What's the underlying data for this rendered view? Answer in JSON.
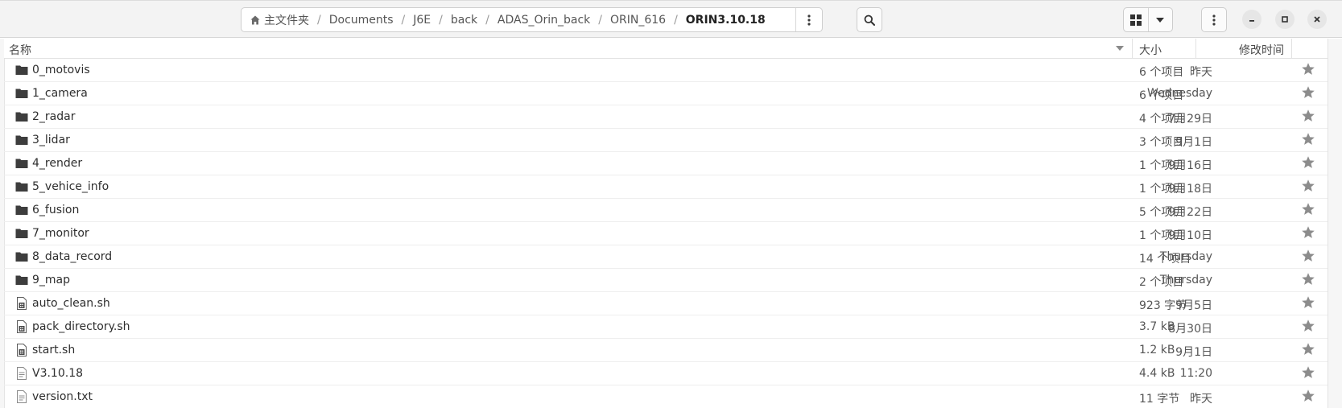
{
  "breadcrumbs": [
    "主文件夹",
    "Documents",
    "J6E",
    "back",
    "ADAS_Orin_back",
    "ORIN_616",
    "ORIN3.10.18"
  ],
  "columns": {
    "name": "名称",
    "size": "大小",
    "modified": "修改时间"
  },
  "files": [
    {
      "name": "0_motovis",
      "type": "folder",
      "size": "6 个项目",
      "modified": "昨天"
    },
    {
      "name": "1_camera",
      "type": "folder",
      "size": "6 个项目",
      "modified": "Wednesday"
    },
    {
      "name": "2_radar",
      "type": "folder",
      "size": "4 个项目",
      "modified": "7月29日"
    },
    {
      "name": "3_lidar",
      "type": "folder",
      "size": "3 个项目",
      "modified": "9月1日"
    },
    {
      "name": "4_render",
      "type": "folder",
      "size": "1 个项目",
      "modified": "9月16日"
    },
    {
      "name": "5_vehice_info",
      "type": "folder",
      "size": "1 个项目",
      "modified": "9月18日"
    },
    {
      "name": "6_fusion",
      "type": "folder",
      "size": "5 个项目",
      "modified": "9月22日"
    },
    {
      "name": "7_monitor",
      "type": "folder",
      "size": "1 个项目",
      "modified": "9月10日"
    },
    {
      "name": "8_data_record",
      "type": "folder",
      "size": "14 个项目",
      "modified": "Thursday"
    },
    {
      "name": "9_map",
      "type": "folder",
      "size": "2 个项目",
      "modified": "Thursday"
    },
    {
      "name": "auto_clean.sh",
      "type": "script",
      "size": "923 字节",
      "modified": "9月5日"
    },
    {
      "name": "pack_directory.sh",
      "type": "script",
      "size": "3.7 kB",
      "modified": "8月30日"
    },
    {
      "name": "start.sh",
      "type": "script",
      "size": "1.2 kB",
      "modified": "9月1日"
    },
    {
      "name": "V3.10.18",
      "type": "text",
      "size": "4.4 kB",
      "modified": "11:20"
    },
    {
      "name": "version.txt",
      "type": "text",
      "size": "11 字节",
      "modified": "昨天"
    }
  ],
  "icons": {
    "home": "home-icon",
    "path_menu": "vertical-dots-icon",
    "search": "search-icon",
    "view": "grid-view-icon",
    "view_options": "chevron-down-icon",
    "main_menu": "vertical-dots-icon",
    "minimize": "minimize-icon",
    "maximize": "maximize-icon",
    "close": "close-icon",
    "folder": "folder-icon",
    "script": "script-file-icon",
    "text": "text-file-icon",
    "star": "star-icon"
  },
  "colors": {
    "folder": "#3d3d3d",
    "star": "#8c8c8c",
    "header_bg": "#f3f3f3",
    "accent": "#2e2e2e"
  }
}
